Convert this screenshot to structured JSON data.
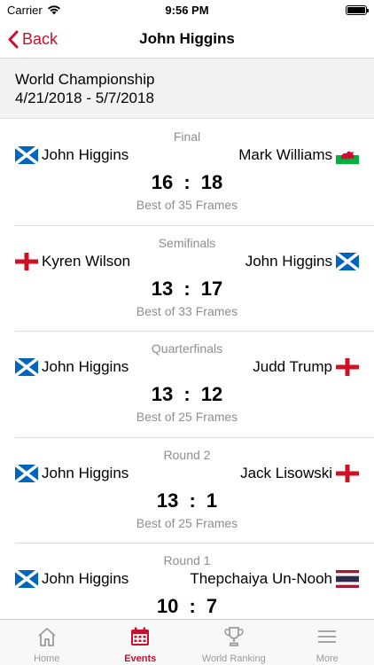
{
  "status_bar": {
    "carrier": "Carrier",
    "time": "9:56 PM",
    "battery_level": 1.0
  },
  "nav": {
    "back_label": "Back",
    "title": "John Higgins"
  },
  "event": {
    "name": "World Championship",
    "dates": "4/21/2018 - 5/7/2018"
  },
  "matches": [
    {
      "round": "Final",
      "player1": "John Higgins",
      "flag1": "scotland",
      "player2": "Mark Williams",
      "flag2": "wales",
      "score1": "16",
      "sep": ":",
      "score2": "18",
      "best_of": "Best of 35 Frames"
    },
    {
      "round": "Semifinals",
      "player1": "Kyren Wilson",
      "flag1": "england",
      "player2": "John Higgins",
      "flag2": "scotland",
      "score1": "13",
      "sep": ":",
      "score2": "17",
      "best_of": "Best of 33 Frames"
    },
    {
      "round": "Quarterfinals",
      "player1": "John Higgins",
      "flag1": "scotland",
      "player2": "Judd Trump",
      "flag2": "england",
      "score1": "13",
      "sep": ":",
      "score2": "12",
      "best_of": "Best of 25 Frames"
    },
    {
      "round": "Round 2",
      "player1": "John Higgins",
      "flag1": "scotland",
      "player2": "Jack Lisowski",
      "flag2": "england",
      "score1": "13",
      "sep": ":",
      "score2": "1",
      "best_of": "Best of 25 Frames"
    },
    {
      "round": "Round 1",
      "player1": "John Higgins",
      "flag1": "scotland",
      "player2": "Thepchaiya Un-Nooh",
      "flag2": "thailand",
      "score1": "10",
      "sep": ":",
      "score2": "7",
      "best_of": ""
    }
  ],
  "tabs": [
    {
      "label": "Home",
      "icon": "home-icon",
      "active": false
    },
    {
      "label": "Events",
      "icon": "calendar-icon",
      "active": true
    },
    {
      "label": "World Ranking",
      "icon": "trophy-icon",
      "active": false
    },
    {
      "label": "More",
      "icon": "menu-icon",
      "active": false
    }
  ],
  "colors": {
    "accent": "#c8102e",
    "secondary_text": "#8e8e93",
    "header_bg": "#f3f3f3"
  }
}
